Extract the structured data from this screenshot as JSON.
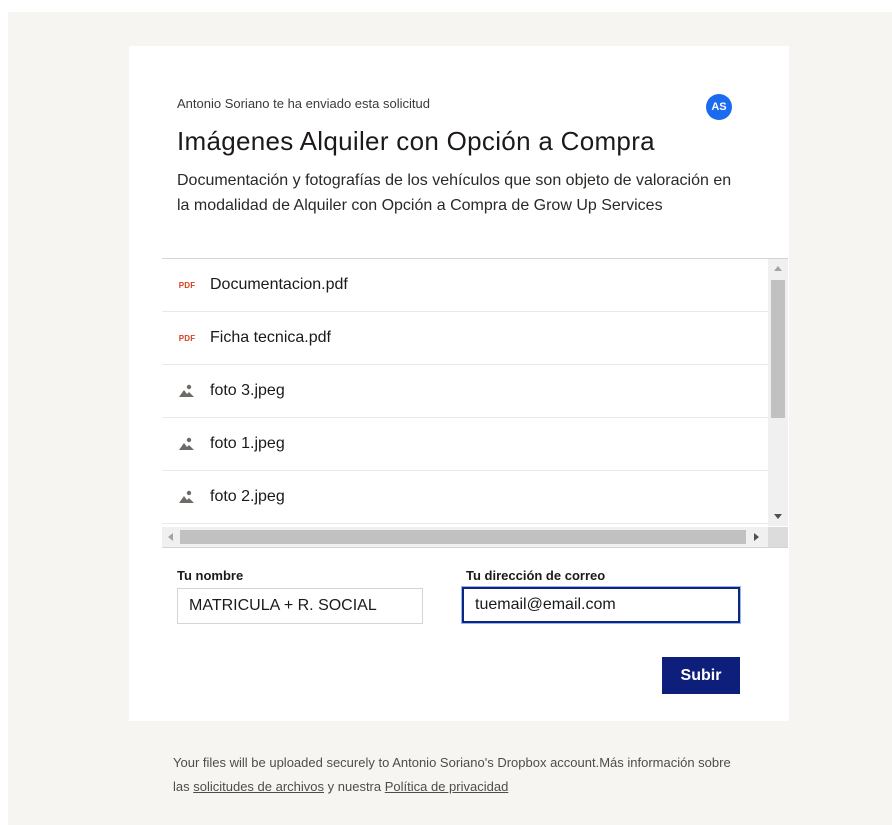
{
  "request": {
    "sender_line": "Antonio Soriano te ha enviado esta solicitud",
    "avatar_initials": "AS",
    "avatar_color": "#1b6bf0",
    "title": "Imágenes Alquiler con Opción a Compra",
    "description": "Documentación y fotografías de los vehículos que son objeto de valoración en la modalidad de Alquiler con Opción a Compra de Grow Up Services"
  },
  "files": [
    {
      "name": "Documentacion.pdf",
      "icon": "pdf-icon",
      "icon_label": "PDF"
    },
    {
      "name": "Ficha tecnica.pdf",
      "icon": "pdf-icon",
      "icon_label": "PDF"
    },
    {
      "name": "foto 3.jpeg",
      "icon": "image-icon"
    },
    {
      "name": "foto 1.jpeg",
      "icon": "image-icon"
    },
    {
      "name": "foto 2.jpeg",
      "icon": "image-icon"
    }
  ],
  "form": {
    "name_label": "Tu nombre",
    "name_value": "MATRICULA + R. SOCIAL",
    "email_label": "Tu dirección de correo",
    "email_value": "tuemail@email.com",
    "submit_label": "Subir"
  },
  "footer": {
    "text_before": "Your files will be uploaded securely to Antonio Soriano's Dropbox account.Más información sobre las ",
    "link_requests": "solicitudes de archivos",
    "text_middle": " y nuestra ",
    "link_privacy": "Política de privacidad"
  },
  "colors": {
    "accent_button": "#0d1f7a",
    "pdf_red": "#d9401f",
    "page_background": "#f7f5f2"
  }
}
